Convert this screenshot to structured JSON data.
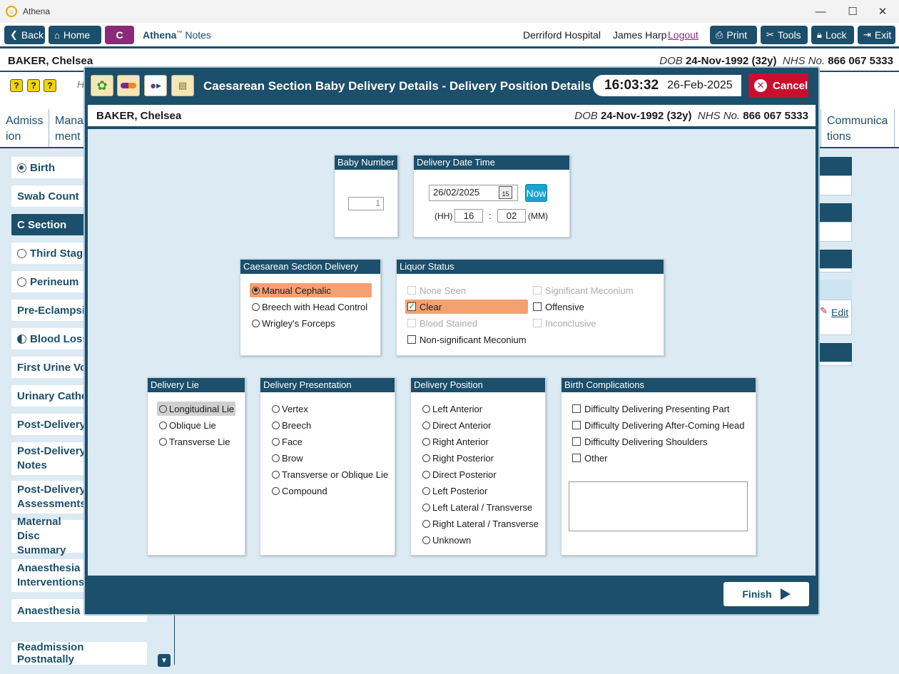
{
  "window": {
    "title": "Athena"
  },
  "toolbar": {
    "back": "Back",
    "home": "Home",
    "c_label": "C",
    "app_name": "Athena",
    "app_tm": "™",
    "app_sub": "Notes",
    "hospital": "Derriford Hospital",
    "user": "James Harp",
    "logout": "Logout",
    "print": "Print",
    "tools": "Tools",
    "lock": "Lock",
    "exit": "Exit"
  },
  "patient": {
    "name": "BAKER, Chelsea",
    "dob_label": "DOB",
    "dob": "24-Nov-1992 (32y)",
    "nhs_label": "NHS No.",
    "nhs": "866 067 5333"
  },
  "help": {
    "partial_text": "H"
  },
  "tabs": {
    "left1": "Admiss ion",
    "left2": "Mana ment",
    "right": "Communica tions"
  },
  "sidebar": {
    "items": [
      {
        "label": "Birth"
      },
      {
        "label": "Swab Count"
      },
      {
        "label": "C Section"
      },
      {
        "label": "Third Stage"
      },
      {
        "label": "Perineum"
      },
      {
        "label": "Pre-Eclampsia"
      },
      {
        "label": "Blood Loss"
      },
      {
        "label": "First Urine Voi"
      },
      {
        "label": "Urinary Cathe"
      },
      {
        "label": "Post-Delivery"
      },
      {
        "label": "Post-Delivery Notes"
      },
      {
        "label": "Post-Delivery Assessments"
      },
      {
        "label": "Maternal Disc Summary"
      },
      {
        "label": "Anaesthesia Interventions"
      },
      {
        "label": "Anaesthesia F"
      },
      {
        "label": "Readmission Postnatally"
      }
    ]
  },
  "right_panel": {
    "edit": "Edit"
  },
  "modal": {
    "title": "Caesarean Section Baby Delivery Details - Delivery Position Details",
    "time": "16:03:32",
    "date": "26-Feb-2025",
    "cancel": "Cancel",
    "finish": "Finish",
    "baby_number": {
      "header": "Baby Number",
      "value": "1"
    },
    "delivery_datetime": {
      "header": "Delivery Date Time",
      "date": "26/02/2025",
      "calendar_day": "15",
      "now": "Now",
      "hh_label": "(HH)",
      "hh": "16",
      "sep": ":",
      "mm": "02",
      "mm_label": "(MM)"
    },
    "cs_type": {
      "header": "Caesarean Section Delivery Type",
      "options": [
        "Manual Cephalic",
        "Breech with Head Control",
        "Wrigley's Forceps"
      ],
      "selected": "Manual Cephalic"
    },
    "liquor": {
      "header": "Liquor Status",
      "options": [
        "None Seen",
        "Significant Meconium",
        "Clear",
        "Offensive",
        "Blood Stained",
        "Inconclusive",
        "Non-significant Meconium"
      ],
      "checked": "Clear"
    },
    "lie": {
      "header": "Delivery Lie",
      "options": [
        "Longitudinal Lie",
        "Oblique Lie",
        "Transverse Lie"
      ]
    },
    "presentation": {
      "header": "Delivery Presentation",
      "options": [
        "Vertex",
        "Breech",
        "Face",
        "Brow",
        "Transverse or Oblique Lie",
        "Compound"
      ]
    },
    "position": {
      "header": "Delivery Position",
      "options": [
        "Left Anterior",
        "Direct Anterior",
        "Right Anterior",
        "Right Posterior",
        "Direct Posterior",
        "Left Posterior",
        "Left Lateral / Transverse",
        "Right Lateral / Transverse",
        "Unknown"
      ]
    },
    "complications": {
      "header": "Birth Complications",
      "options": [
        "Difficulty Delivering Presenting Part",
        "Difficulty Delivering After-Coming Head",
        "Difficulty Delivering Shoulders",
        "Other"
      ],
      "notes": ""
    }
  },
  "colors": {
    "primary": "#1b4f6b",
    "accent": "#8c2a7a",
    "cancel": "#c8102e",
    "selected": "#f4a070",
    "now": "#1ba3cf",
    "background": "#dbeaf3"
  },
  "icons": [
    "back-arrow-icon",
    "home-icon",
    "print-icon",
    "tools-icon",
    "lock-icon",
    "exit-icon",
    "help-icon",
    "calendar-icon",
    "cancel-x-icon",
    "play-arrow-icon",
    "pencil-icon"
  ]
}
